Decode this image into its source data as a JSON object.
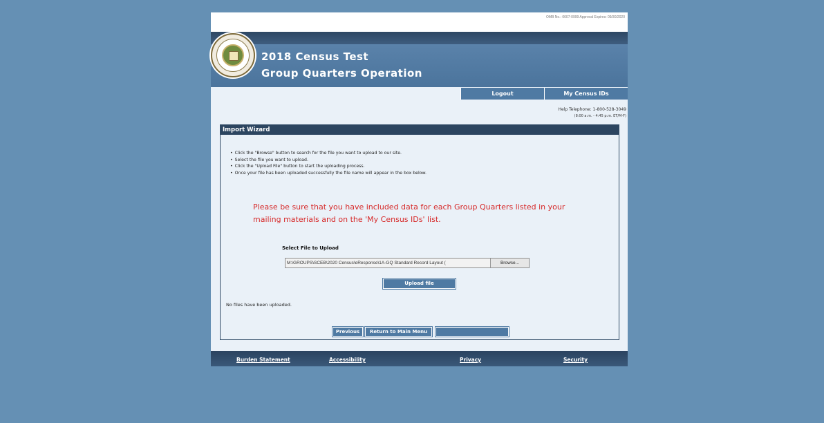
{
  "header": {
    "omb": "OMB No.: 0607-0999 Approval Expires: 09/30/2020",
    "title_line1": "2018 Census Test",
    "title_line2": "Group Quarters Operation"
  },
  "nav": {
    "logout": "Logout",
    "my_census_ids": "My Census IDs"
  },
  "help": {
    "phone": "Help Telephone: 1-800-528-3049",
    "hours": "(8:00 a.m. - 4:45 p.m. ET/M-F)"
  },
  "wizard": {
    "title": "Import Wizard",
    "steps": [
      "Click the \"Browse\" button to search for the file you want to upload to our site.",
      "Select the file you want to upload.",
      "Click the \"Upload File\" button to start the uploading process.",
      "Once your file has been uploaded successfully the file name will appear in the box below."
    ],
    "warning": "Please be sure that you have included data for each Group Quarters listed in your mailing materials and on the 'My Census IDs' list.",
    "select_label": "Select File to Upload",
    "file_path": "M:\\GROUPS\\SCEB\\2020 Census\\eResponse\\1A-GQ Standard Record Layout (",
    "browse_label": "Browse...",
    "upload_label": "Upload file",
    "status": "No files have been uploaded.",
    "previous_label": "Previous",
    "main_menu_label": "Return to Main Menu"
  },
  "footer": {
    "burden": "Burden Statement",
    "accessibility": "Accessibility",
    "privacy": "Privacy",
    "security": "Security"
  },
  "colors": {
    "background": "#6590b4",
    "header_blue": "#5a82aa",
    "dark_navy": "#2c4560",
    "button_blue": "#4f7aa3",
    "warning_red": "#d62727"
  }
}
